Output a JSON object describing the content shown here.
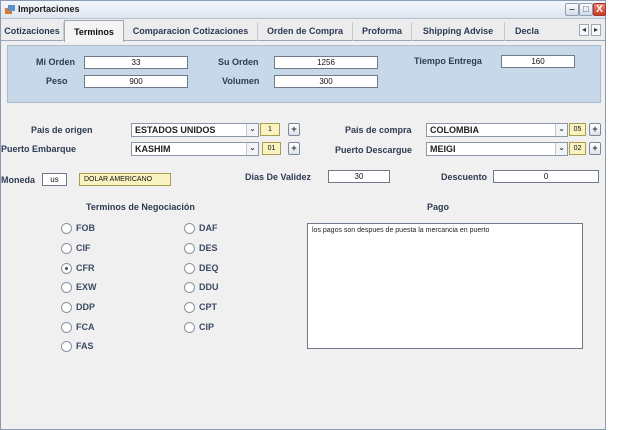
{
  "window": {
    "title": "Importaciones",
    "buttons": {
      "minimize": "–",
      "maximize": "□",
      "close": "X"
    }
  },
  "tabs": [
    {
      "label": "Cotizaciones",
      "active": false
    },
    {
      "label": "Terminos",
      "active": true
    },
    {
      "label": "Comparacion Cotizaciones",
      "active": false
    },
    {
      "label": "Orden de Compra",
      "active": false
    },
    {
      "label": "Proforma",
      "active": false
    },
    {
      "label": "Shipping Advise",
      "active": false
    },
    {
      "label": "Decla",
      "active": false
    }
  ],
  "tab_scroll": {
    "left": "◂",
    "right": "▸"
  },
  "top_panel": {
    "mi_orden": {
      "label": "Mi Orden",
      "value": "33"
    },
    "su_orden": {
      "label": "Su Orden",
      "value": "1256"
    },
    "tiempo_entrega": {
      "label": "Tiempo Entrega",
      "value": "160"
    },
    "peso": {
      "label": "Peso",
      "value": "900"
    },
    "volumen": {
      "label": "Volumen",
      "value": "300"
    }
  },
  "origin": {
    "pais_origen": {
      "label": "Pais de origen",
      "value": "ESTADOS UNIDOS",
      "code": "1"
    },
    "puerto_embarque": {
      "label": "Puerto Embarque",
      "value": "KASHIM",
      "code": "01"
    },
    "pais_compra": {
      "label": "Pais de compra",
      "value": "COLOMBIA",
      "code": "05"
    },
    "puerto_descargue": {
      "label": "Puerto Descargue",
      "value": "MEIGI",
      "code": "02"
    }
  },
  "moneda": {
    "label": "Moneda",
    "code": "us",
    "name": "DOLAR AMERICANO"
  },
  "dias_validez": {
    "label": "Dias De Validez",
    "value": "30"
  },
  "descuento": {
    "label": "Descuento",
    "value": "0"
  },
  "terminos": {
    "title": "Terminos de Negociación",
    "col1": [
      {
        "label": "FOB",
        "checked": false
      },
      {
        "label": "CIF",
        "checked": false
      },
      {
        "label": "CFR",
        "checked": true
      },
      {
        "label": "EXW",
        "checked": false
      },
      {
        "label": "DDP",
        "checked": false
      },
      {
        "label": "FCA",
        "checked": false
      },
      {
        "label": "FAS",
        "checked": false
      }
    ],
    "col2": [
      {
        "label": "DAF",
        "checked": false
      },
      {
        "label": "DES",
        "checked": false
      },
      {
        "label": "DEQ",
        "checked": false
      },
      {
        "label": "DDU",
        "checked": false
      },
      {
        "label": "CPT",
        "checked": false
      },
      {
        "label": "CIP",
        "checked": false
      }
    ]
  },
  "pago": {
    "title": "Pago",
    "text": "los pagos son despues de puesta la mercancia en puerto"
  },
  "icons": {
    "combo_arrow": "⌄",
    "add": "+"
  }
}
